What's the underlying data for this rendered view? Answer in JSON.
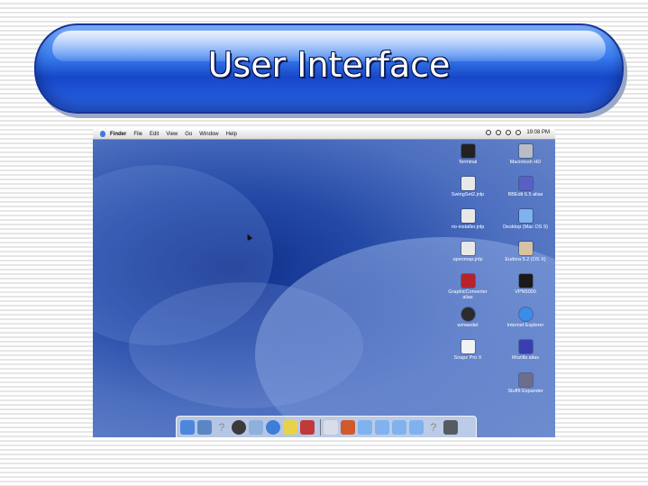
{
  "slide": {
    "title": "User Interface"
  },
  "menubar": {
    "items": [
      "Finder",
      "File",
      "Edit",
      "View",
      "Go",
      "Window",
      "Help"
    ],
    "clock": "19:08 PM"
  },
  "desktop": {
    "icons": [
      {
        "label": "Terminal",
        "label2": "",
        "icon": "terminal-icon",
        "color": "#222222"
      },
      {
        "label": "Macintosh HD",
        "label2": "",
        "icon": "hard-drive-icon",
        "color": "#b9bcc4"
      },
      {
        "label": "SwingSet2.jnlp",
        "label2": "",
        "icon": "document-icon",
        "color": "#e8e8e8"
      },
      {
        "label": "BBEdit 6.5 alias",
        "label2": "",
        "icon": "bbedit-icon",
        "color": "#5a5fc7"
      },
      {
        "label": "rio-installer.jnlp",
        "label2": "",
        "icon": "document-icon",
        "color": "#e8e8e8"
      },
      {
        "label": "Desktop (Mac OS 9)",
        "label2": "",
        "icon": "folder-icon",
        "color": "#7fb2ee"
      },
      {
        "label": "openmap.jnlp",
        "label2": "",
        "icon": "document-icon",
        "color": "#e8e8e8"
      },
      {
        "label": "Eudora 5.2 (OS X)",
        "label2": "",
        "icon": "eudora-icon",
        "color": "#d9c2a2"
      },
      {
        "label": "GraphicConverter",
        "label2": "alias",
        "icon": "graphic-converter-icon",
        "color": "#b8232a"
      },
      {
        "label": "VPN5000",
        "label2": "",
        "icon": "vpn-icon",
        "color": "#1a1a1a"
      },
      {
        "label": "wmwedel",
        "label2": "",
        "icon": "globe-icon",
        "color": "#2b2b2b"
      },
      {
        "label": "Internet Explorer",
        "label2": "",
        "icon": "internet-explorer-icon",
        "color": "#3a8de8"
      },
      {
        "label": "Snapz Pro X",
        "label2": "",
        "icon": "snapz-icon",
        "color": "#f2f2f2"
      },
      {
        "label": "Mozilla alias",
        "label2": "",
        "icon": "mozilla-icon",
        "color": "#3a3fb0"
      },
      {
        "label": "",
        "label2": "",
        "icon": "",
        "color": ""
      },
      {
        "label": "StuffIt Expander",
        "label2": "",
        "icon": "stuffit-icon",
        "color": "#6e6e8a"
      }
    ]
  },
  "dock": {
    "icons": [
      {
        "icon": "finder-icon",
        "color": "#4d86dd"
      },
      {
        "icon": "mail-icon",
        "color": "#5a86c4"
      },
      {
        "icon": "help-icon",
        "color": "",
        "glyph": "?"
      },
      {
        "icon": "network-icon",
        "color": "#3a3a3a"
      },
      {
        "icon": "itunes-icon",
        "color": "#8fb0dd"
      },
      {
        "icon": "quicktime-icon",
        "color": "#3d7ed6"
      },
      {
        "icon": "stickies-icon",
        "color": "#e8d24a"
      },
      {
        "icon": "cube-icon",
        "color": "#c0393b"
      },
      {
        "icon": "textedit-icon",
        "color": "#d8dde8"
      },
      {
        "icon": "home-icon",
        "color": "#d05a2a"
      },
      {
        "icon": "folder-icon",
        "color": "#7fb2ee"
      },
      {
        "icon": "folder-icon",
        "color": "#7fb2ee"
      },
      {
        "icon": "folder-icon",
        "color": "#7fb2ee"
      },
      {
        "icon": "folder-icon",
        "color": "#7fb2ee"
      },
      {
        "icon": "help-icon",
        "color": "",
        "glyph": "?"
      },
      {
        "icon": "trash-icon",
        "color": "#555a63"
      }
    ]
  }
}
